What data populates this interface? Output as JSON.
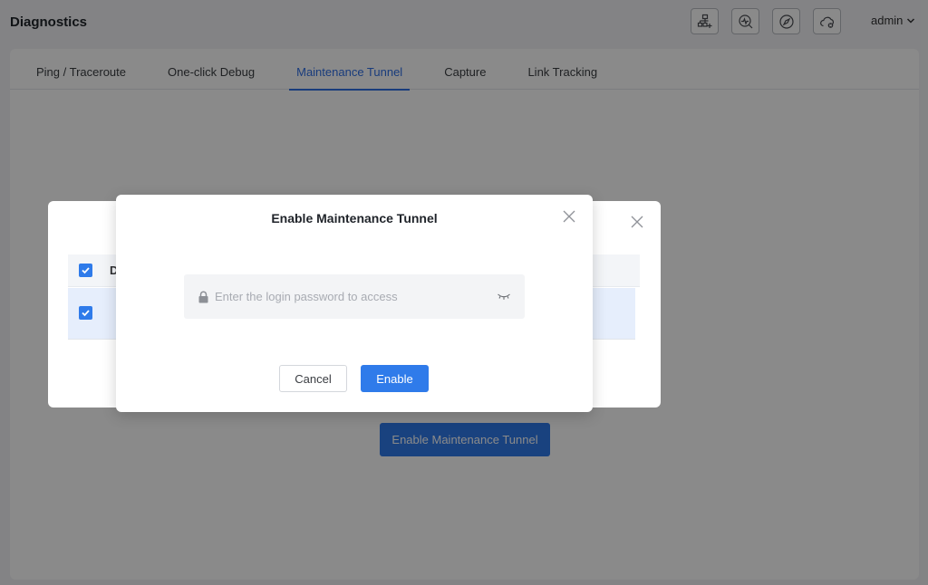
{
  "header": {
    "title": "Diagnostics",
    "icons": [
      "topology-add-icon",
      "diagnose-icon",
      "compass-icon",
      "cloud-error-icon"
    ],
    "user": "admin"
  },
  "tabs": [
    {
      "label": "Ping / Traceroute",
      "active": false
    },
    {
      "label": "One-click Debug",
      "active": false
    },
    {
      "label": "Maintenance Tunnel",
      "active": true
    },
    {
      "label": "Capture",
      "active": false
    },
    {
      "label": "Link Tracking",
      "active": false
    }
  ],
  "main": {
    "enable_button": "Enable Maintenance Tunnel"
  },
  "background_dialog": {
    "column_header_visible": "D"
  },
  "modal": {
    "title": "Enable Maintenance Tunnel",
    "password_placeholder": "Enter the login password to access",
    "password_value": "",
    "cancel_label": "Cancel",
    "enable_label": "Enable"
  },
  "colors": {
    "accent": "#2f7bea",
    "tab_active": "#2f6fe6",
    "overlay": "rgba(0,0,0,0.46)"
  }
}
